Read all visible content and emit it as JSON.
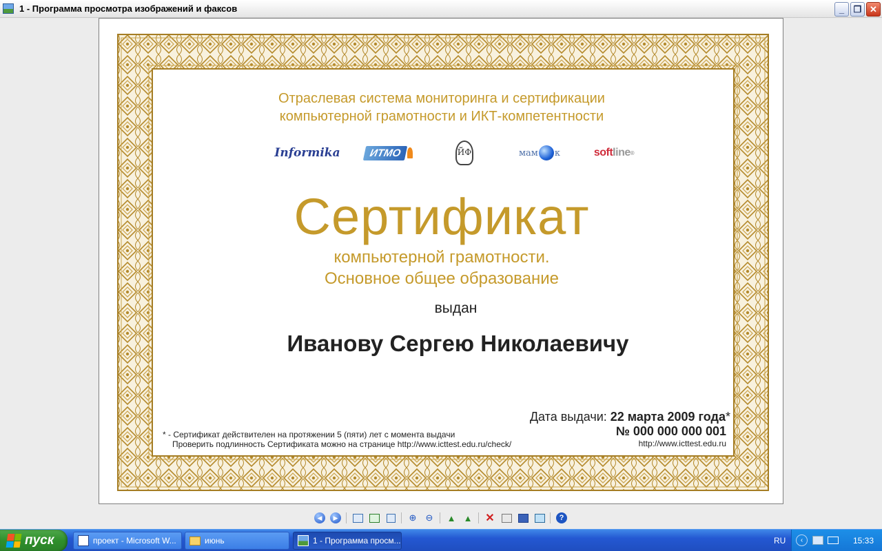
{
  "window": {
    "title": "1 - Программа просмотра изображений и факсов",
    "minimize": "_",
    "maximize": "❐",
    "close": "✕"
  },
  "certificate": {
    "org_line1": "Отраслевая система мониторинга и сертификации",
    "org_line2": "компьютерной грамотности и ИКТ-компетентности",
    "logos": {
      "informika": "Informika",
      "itmo": "ИТМО",
      "book": "ЙФ",
      "mamont_left": "мам",
      "mamont_right": "к",
      "softline_soft": "soft",
      "softline_line": "line",
      "softline_mark": "®"
    },
    "title": "Сертификат",
    "subtitle1": "компьютерной грамотности.",
    "subtitle2": "Основное общее образование",
    "issued": "выдан",
    "holder": "Иванову Сергею Николаевичу",
    "date_label": "Дата выдачи:",
    "date_value": "22 марта 2009 года",
    "date_mark": "*",
    "number": "№ 000 000 000 001",
    "url": "http://www.icttest.edu.ru",
    "footnote1": "* - Сертификат действителен на протяжении 5 (пяти) лет с момента выдачи",
    "footnote2": "Проверить подлинность Сертификата можно на странице http://www.icttest.edu.ru/check/",
    "accent_color": "#c59a2b"
  },
  "toolbar": {
    "icons": [
      "prev-icon",
      "next-icon",
      "best-fit-icon",
      "actual-size-icon",
      "slideshow-icon",
      "zoom-in-icon",
      "zoom-out-icon",
      "rotate-cw-icon",
      "rotate-ccw-icon",
      "delete-icon",
      "print-icon",
      "save-icon",
      "edit-icon",
      "help-icon"
    ],
    "help": "?"
  },
  "taskbar": {
    "start": "пуск",
    "tasks": [
      {
        "label": "проект - Microsoft W..."
      },
      {
        "label": "июнь"
      },
      {
        "label": "1 - Программа просм..."
      }
    ],
    "lang": "RU",
    "clock": "15:33"
  }
}
